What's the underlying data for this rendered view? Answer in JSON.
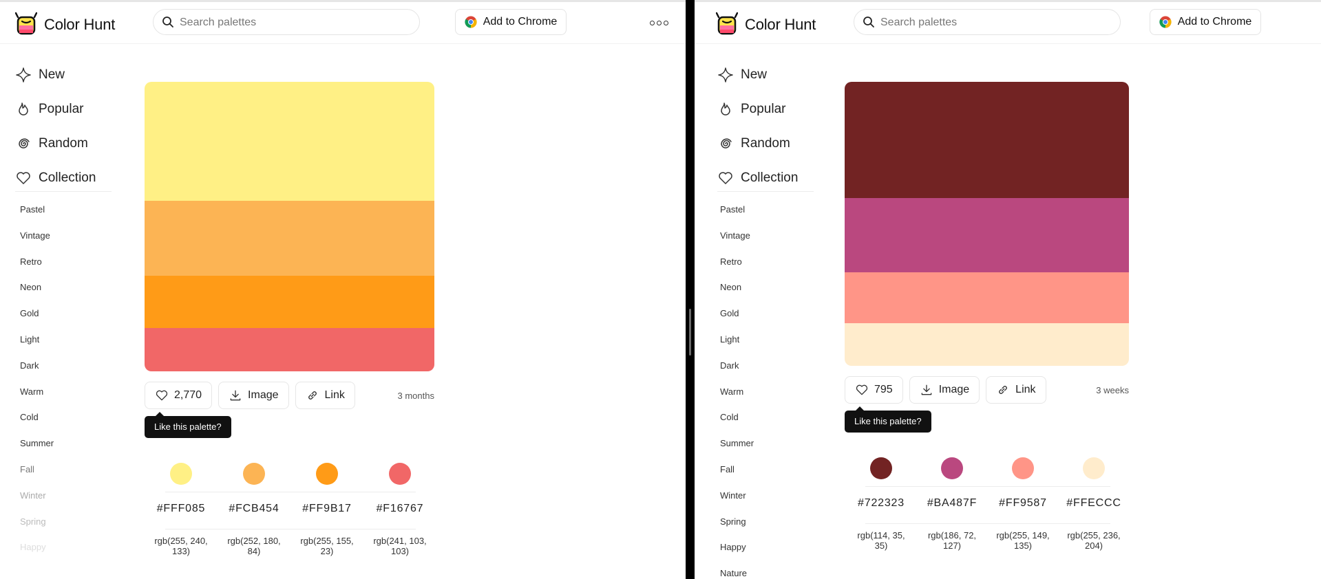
{
  "app": {
    "brand": "Color Hunt",
    "search_placeholder": "Search palettes",
    "chrome_button": "Add to Chrome"
  },
  "nav": {
    "main": [
      "New",
      "Popular",
      "Random",
      "Collection"
    ],
    "main_icons": [
      "diamond-icon",
      "flame-icon",
      "spiral-icon",
      "heart-icon"
    ]
  },
  "left": {
    "tags": [
      "Pastel",
      "Vintage",
      "Retro",
      "Neon",
      "Gold",
      "Light",
      "Dark",
      "Warm",
      "Cold",
      "Summer",
      "Fall",
      "Winter",
      "Spring",
      "Happy"
    ],
    "palette": [
      "#FFF085",
      "#FCB454",
      "#FF9B17",
      "#F16767"
    ],
    "band_shares": [
      0.41,
      0.26,
      0.18,
      0.15
    ],
    "likes": "2,770",
    "image_label": "Image",
    "link_label": "Link",
    "age": "3 months",
    "tooltip": "Like this palette?",
    "swatches": [
      {
        "hex": "#FFF085",
        "rgb": "rgb(255, 240, 133)"
      },
      {
        "hex": "#FCB454",
        "rgb": "rgb(252, 180, 84)"
      },
      {
        "hex": "#FF9B17",
        "rgb": "rgb(255, 155, 23)"
      },
      {
        "hex": "#F16767",
        "rgb": "rgb(241, 103, 103)"
      }
    ]
  },
  "right": {
    "tags": [
      "Pastel",
      "Vintage",
      "Retro",
      "Neon",
      "Gold",
      "Light",
      "Dark",
      "Warm",
      "Cold",
      "Summer",
      "Fall",
      "Winter",
      "Spring",
      "Happy",
      "Nature"
    ],
    "palette": [
      "#722323",
      "#BA487F",
      "#FF9587",
      "#FFECCC"
    ],
    "band_shares": [
      0.41,
      0.26,
      0.18,
      0.15
    ],
    "likes": "795",
    "image_label": "Image",
    "link_label": "Link",
    "age": "3 weeks",
    "tooltip": "Like this palette?",
    "swatches": [
      {
        "hex": "#722323",
        "rgb": "rgb(114, 35, 35)"
      },
      {
        "hex": "#BA487F",
        "rgb": "rgb(186, 72, 127)"
      },
      {
        "hex": "#FF9587",
        "rgb": "rgb(255, 149, 135)"
      },
      {
        "hex": "#FFECCC",
        "rgb": "rgb(255, 236, 204)"
      }
    ]
  }
}
